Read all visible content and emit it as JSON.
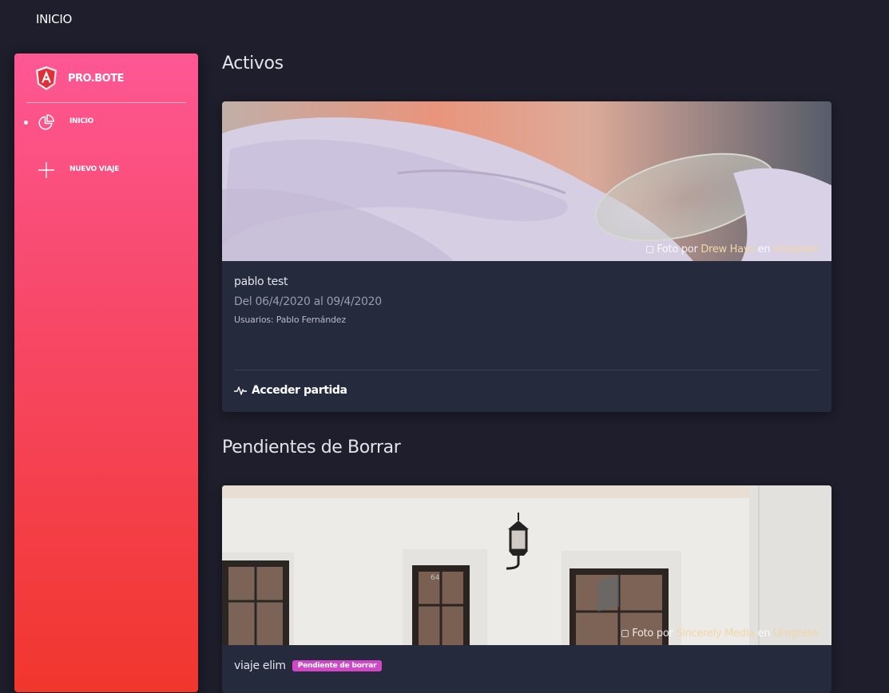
{
  "topbar": {
    "title": "INICIO"
  },
  "brand": {
    "name": "PRO.BOTE",
    "logo_icon": "angular-logo-icon"
  },
  "sidebar": {
    "items": [
      {
        "label": "INICIO",
        "icon": "pie-chart-icon",
        "active": true
      },
      {
        "label": "NUEVO VIAJE",
        "icon": "plus-icon",
        "active": false
      }
    ]
  },
  "sections": {
    "active": {
      "title": "Activos",
      "card": {
        "name": "pablo test",
        "dates": "Del 06/4/2020 al 09/4/2020",
        "users": "Usuarios: Pablo Fernández",
        "credit_prefix": "Foto por",
        "credit_author": "Drew Hays",
        "credit_joiner": "en",
        "credit_site": "Unsplash",
        "action_label": "Acceder partida",
        "action_icon": "pulse-icon"
      }
    },
    "pending": {
      "title": "Pendientes de Borrar",
      "card": {
        "name": "viaje elim",
        "badge": "Pendiente de borrar",
        "credit_prefix": "Foto por",
        "credit_author": "Sincerely Media",
        "credit_joiner": "en",
        "credit_site": "Unsplash"
      }
    }
  },
  "colors": {
    "background": "#1e1e2c",
    "card": "#262a3d",
    "sidebar_top": "#fe5794",
    "sidebar_bottom": "#f1362d",
    "badge": "#d047c8",
    "credit_link": "#f3d6a6"
  }
}
